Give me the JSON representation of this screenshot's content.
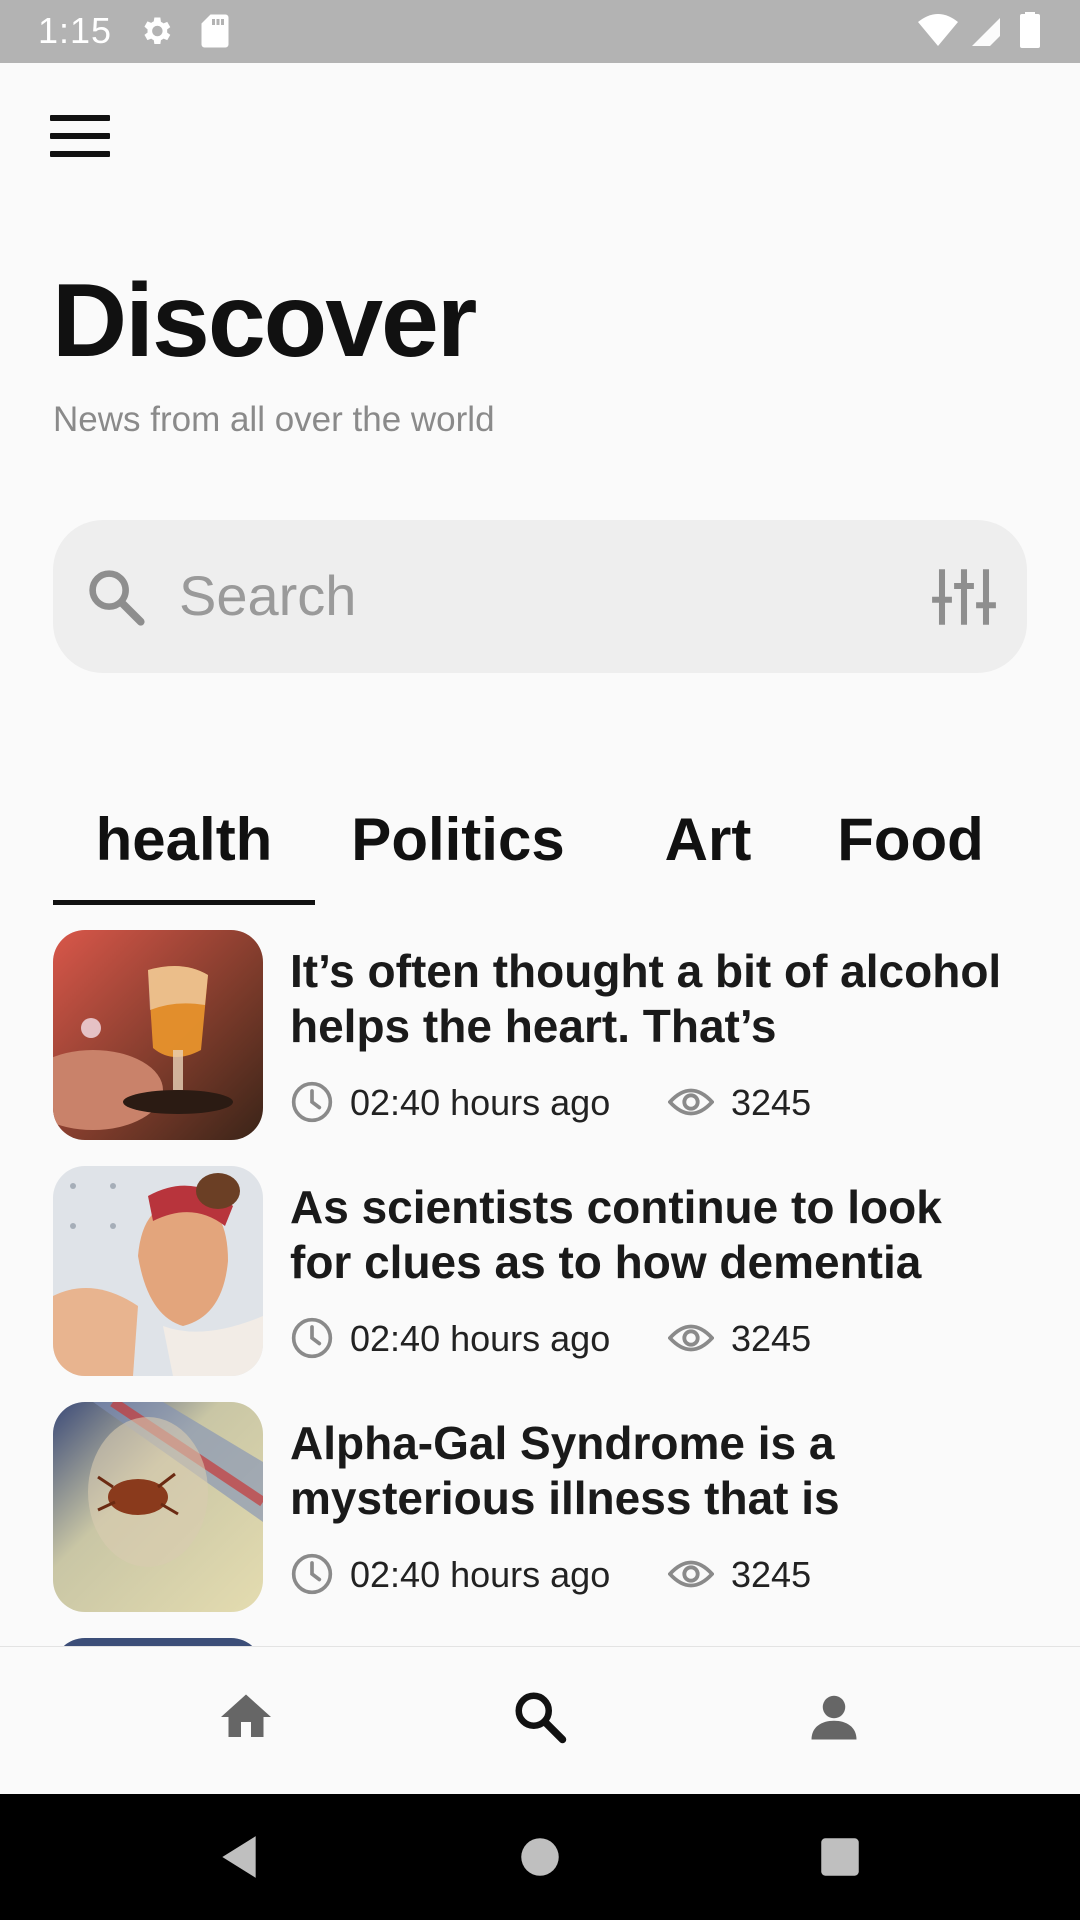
{
  "status_bar": {
    "time": "1:15"
  },
  "header": {
    "title": "Discover",
    "subtitle": "News from all over the world"
  },
  "search": {
    "placeholder": "Search",
    "value": ""
  },
  "tabs": [
    {
      "label": "health",
      "selected": true
    },
    {
      "label": "Politics",
      "selected": false
    },
    {
      "label": "Art",
      "selected": false
    },
    {
      "label": "Food",
      "selected": false
    }
  ],
  "articles": [
    {
      "title": "It’s often thought a bit of alcohol helps the heart. That’s",
      "time": "02:40 hours ago",
      "views": "3245"
    },
    {
      "title": "As scientists continue to look for clues as to how dementia",
      "time": "02:40 hours ago",
      "views": "3245"
    },
    {
      "title": "Alpha-Gal Syndrome is a mysterious illness that is",
      "time": "02:40 hours ago",
      "views": "3245"
    }
  ],
  "bottom_nav": {
    "items": [
      "home-icon",
      "search-icon",
      "person-icon"
    ],
    "active": "search-icon"
  },
  "colors": {
    "background": "#fafafa",
    "search_bg": "#eeeeee",
    "status_bar": "#b3b3b3",
    "text": "#111111",
    "muted": "#8a8a8a"
  }
}
